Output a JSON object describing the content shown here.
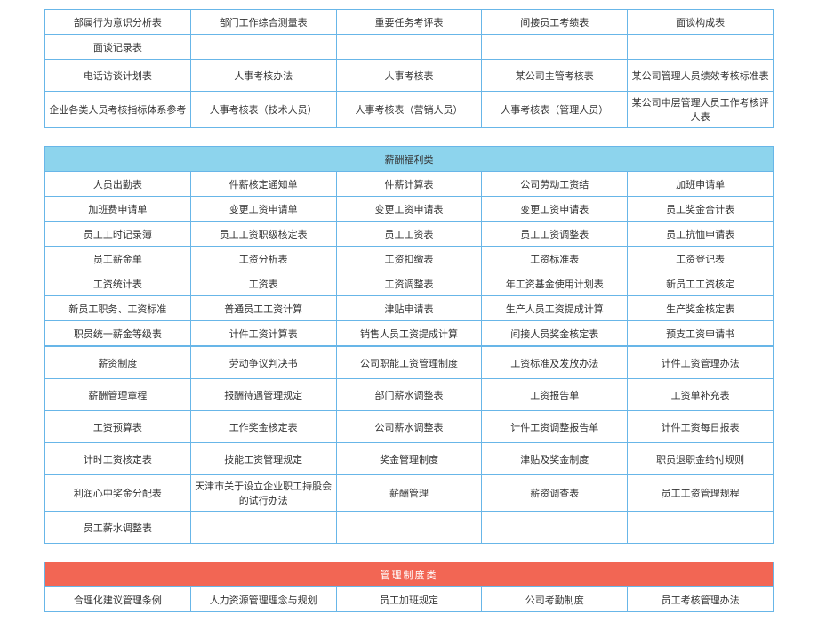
{
  "table1": {
    "rows": [
      [
        "部属行为意识分析表",
        "部门工作综合测量表",
        "重要任务考评表",
        "间接员工考绩表",
        "面谈构成表"
      ],
      [
        "面谈记录表",
        "",
        "",
        "",
        ""
      ],
      [
        "电话访谈计划表",
        "人事考核办法",
        "人事考核表",
        "某公司主管考核表",
        "某公司管理人员绩效考核标准表"
      ],
      [
        "企业各类人员考核指标体系参考",
        "人事考核表（技术人员）",
        "人事考核表（营销人员）",
        "人事考核表（管理人员）",
        "某公司中层管理人员工作考核评人表"
      ]
    ]
  },
  "table2": {
    "header": "薪酬福利类",
    "rows": [
      [
        "人员出勤表",
        "件薪核定通知单",
        "件薪计算表",
        "公司劳动工资结",
        "加班申请单"
      ],
      [
        "加班费申请单",
        "变更工资申请单",
        "变更工资申请表",
        "变更工资申请表",
        "员工奖金合计表"
      ],
      [
        "员工工时记录簿",
        "员工工资职级核定表",
        "员工工资表",
        "员工工资调整表",
        "员工抗恤申请表"
      ],
      [
        "员工薪金单",
        "工资分析表",
        "工资扣缴表",
        "工资标准表",
        "工资登记表"
      ],
      [
        "工资统计表",
        "工资表",
        "工资调整表",
        "年工资基金使用计划表",
        "新员工工资核定"
      ],
      [
        "新员工职务、工资标准",
        "普通员工工资计算",
        "津贴申请表",
        "生产人员工资提成计算",
        "生产奖金核定表"
      ],
      [
        "职员统一薪金等级表",
        "计件工资计算表",
        "销售人员工资提成计算",
        "间接人员奖金核定表",
        "预支工资申请书"
      ]
    ],
    "rows2": [
      [
        "薪资制度",
        "劳动争议判决书",
        "公司职能工资管理制度",
        "工资标准及发放办法",
        "计件工资管理办法"
      ],
      [
        "薪酬管理章程",
        "报酬待遇管理规定",
        "部门薪水调整表",
        "工资报告单",
        "工资单补充表"
      ],
      [
        "工资预算表",
        "工作奖金核定表",
        "公司薪水调整表",
        "计件工资调整报告单",
        "计件工资每日报表"
      ],
      [
        "计时工资核定表",
        "技能工资管理规定",
        "奖金管理制度",
        "津贴及奖金制度",
        "职员退职金给付规则"
      ],
      [
        "利润心中奖金分配表",
        "天津市关于设立企业职工持股会的试行办法",
        "薪酬管理",
        "薪资调查表",
        "员工工资管理规程"
      ],
      [
        "员工薪水调整表",
        "",
        "",
        "",
        ""
      ]
    ]
  },
  "table3": {
    "header": "管理制度类",
    "rows": [
      [
        "合理化建议管理条例",
        "人力资源管理理念与规划",
        "员工加班规定",
        "公司考勤制度",
        "员工考核管理办法"
      ]
    ]
  }
}
